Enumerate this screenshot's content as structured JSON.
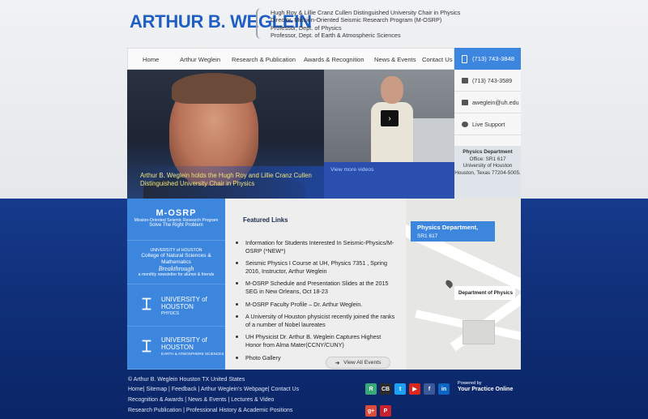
{
  "header": {
    "logo": "ARTHUR B. WEGLEIN",
    "titles": [
      "Hugh Roy & Lillie Cranz Cullen Distinguished University Chair in Physics",
      "Director, Mission-Oriented Seismic Research Program (M-OSRP)",
      "Professor, Dept. of Physics",
      "Professor, Dept. of Earth & Atmospheric Sciences"
    ]
  },
  "nav": {
    "items": [
      "Home",
      "Arthur Weglein",
      "Research & Publication",
      "Awards & Recognition",
      "News & Events",
      "Contact Us"
    ],
    "phone": "(713) 743-3848"
  },
  "contact": {
    "fax": "(713) 743-3589",
    "email": "aweglein@uh.edu",
    "support": "Live Support",
    "dept_title": "Physics Department",
    "dept_lines": [
      "Office: SR1 617",
      "University of Houston",
      "Houston, Texas 77204-5005."
    ]
  },
  "hero": {
    "caption": "Arthur B. Weglein holds the Hugh Roy and Lillie Cranz Cullen Distinguished University Chair in Physics",
    "view_videos": "View more videos"
  },
  "sidebar_links": [
    {
      "big": "M-OSRP",
      "small": "Mission-Oriented Seismic Research Program",
      "tag": "Solve The Right Problem"
    },
    {
      "big": "College of Natural Sciences & Mathematics",
      "small": "UNIVERSITY of HOUSTON",
      "tag": "Breakthrough",
      "sub": "a monthly newsletter for alumni & friends"
    },
    {
      "big": "UNIVERSITY of HOUSTON",
      "small": "PHYSICS"
    },
    {
      "big": "UNIVERSITY of HOUSTON",
      "small": "EARTH & ATMOSPHERE SCIENCES"
    }
  ],
  "featured": {
    "heading": "Featured Links",
    "items": [
      "Information for Students Interested In Seismic-Physics/M-OSRP (*NEW*)",
      "Seismic Physics I Course at UH, Physics 7351 , Spring 2016, Instructor, Arthur Weglein",
      "M-OSRP Schedule and Presentation Slides at the 2015 SEG in New Orleans, Oct 18-23",
      "M-OSRP Faculty Profile – Dr. Arthur Weglein.",
      "A University of Houston physicist recently joined the ranks of a number of Nobel laureates",
      "UH Physicist Dr. Arthur B. Weglein Captures Highest Honor from Alma Mater(CCNY/CUNY)",
      "Photo Gallery"
    ],
    "view_all": "View All Events"
  },
  "map": {
    "label_title": "Physics Department,",
    "label_sub": "SR1 617",
    "tooltip": "Department of Physics"
  },
  "footer": {
    "copyright": "© Arthur B. Weglein Houston TX United States",
    "line1": "Home| Sitemap | Feedback | Arthur Weglein's Webpage| Contact Us",
    "line2": "Recognition & Awards | News & Events | Lectures & Video",
    "line3": "Research Publication | Professional History & Academic Positions",
    "powered_small": "Powered by",
    "powered_brand": "Your Practice Online",
    "social": [
      {
        "name": "researchgate",
        "label": "R",
        "color": "#39a877"
      },
      {
        "name": "cb",
        "label": "CB",
        "color": "#2b2b2b"
      },
      {
        "name": "twitter",
        "label": "t",
        "color": "#1da1f2"
      },
      {
        "name": "youtube",
        "label": "▶",
        "color": "#d8281d"
      },
      {
        "name": "facebook",
        "label": "f",
        "color": "#3b5998"
      },
      {
        "name": "linkedin",
        "label": "in",
        "color": "#0a66c2"
      },
      {
        "name": "googleplus",
        "label": "g+",
        "color": "#dd4b39"
      },
      {
        "name": "pinterest",
        "label": "P",
        "color": "#c8232c"
      }
    ]
  }
}
